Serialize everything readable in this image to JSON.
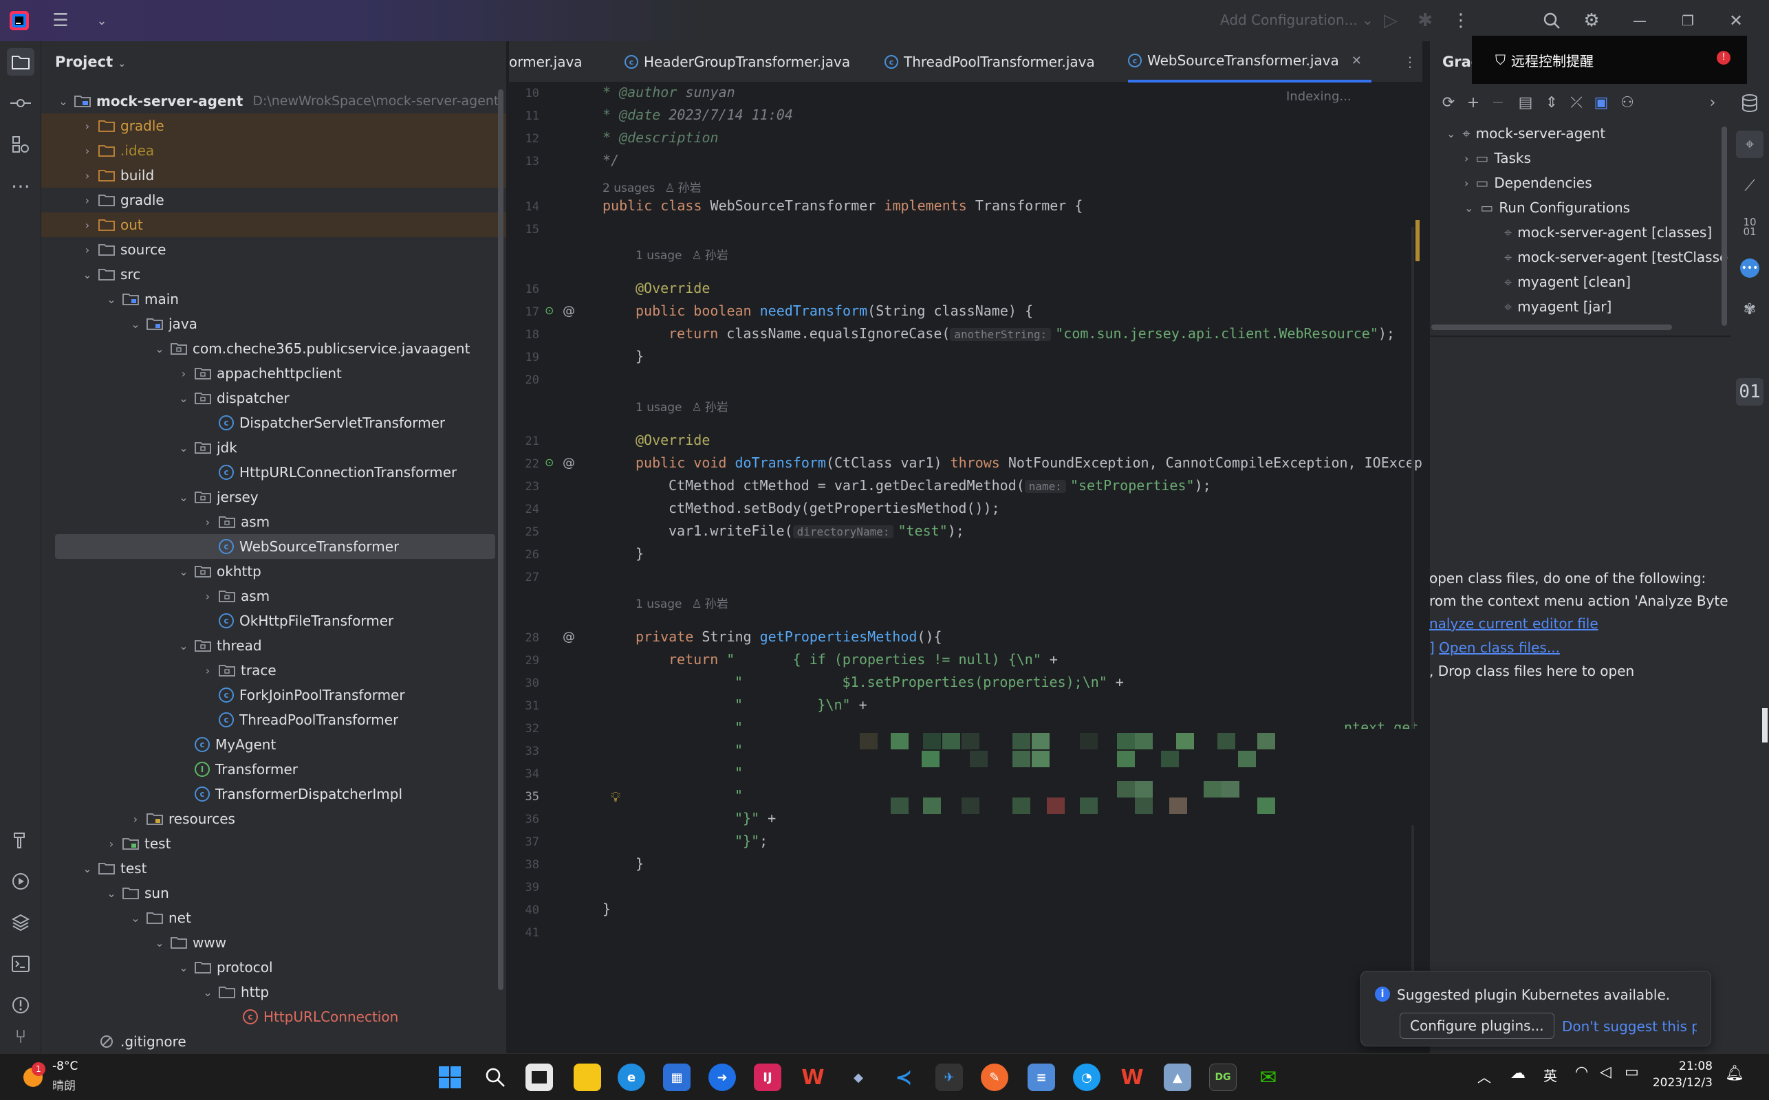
{
  "titlebar": {
    "add_configuration": "Add Configuration..."
  },
  "project_panel": {
    "title": "Project",
    "root": {
      "label": "mock-server-agent",
      "path": "D:\\newWrokSpace\\mock-server-agent"
    },
    "items": [
      {
        "label": "gradle"
      },
      {
        "label": ".idea"
      },
      {
        "label": "build"
      },
      {
        "label": "gradle"
      },
      {
        "label": "out"
      },
      {
        "label": "source"
      },
      {
        "label": "src"
      },
      {
        "label": "main"
      },
      {
        "label": "java"
      },
      {
        "label": "com.cheche365.publicservice.javaagent"
      },
      {
        "label": "appachehttpclient"
      },
      {
        "label": "dispatcher"
      },
      {
        "label": "DispatcherServletTransformer"
      },
      {
        "label": "jdk"
      },
      {
        "label": "HttpURLConnectionTransformer"
      },
      {
        "label": "jersey"
      },
      {
        "label": "asm"
      },
      {
        "label": "WebSourceTransformer"
      },
      {
        "label": "okhttp"
      },
      {
        "label": "asm"
      },
      {
        "label": "OkHttpFileTransformer"
      },
      {
        "label": "thread"
      },
      {
        "label": "trace"
      },
      {
        "label": "ForkJoinPoolTransformer"
      },
      {
        "label": "ThreadPoolTransformer"
      },
      {
        "label": "MyAgent"
      },
      {
        "label": "Transformer"
      },
      {
        "label": "TransformerDispatcherImpl"
      },
      {
        "label": "resources"
      },
      {
        "label": "test"
      },
      {
        "label": "test"
      },
      {
        "label": "sun"
      },
      {
        "label": "net"
      },
      {
        "label": "www"
      },
      {
        "label": "protocol"
      },
      {
        "label": "http"
      },
      {
        "label": "HttpURLConnection"
      },
      {
        "label": ".gitignore"
      }
    ]
  },
  "tabs": [
    {
      "label": "ormer.java"
    },
    {
      "label": "HeaderGroupTransformer.java"
    },
    {
      "label": "ThreadPoolTransformer.java"
    },
    {
      "label": "WebSourceTransformer.java"
    }
  ],
  "editor": {
    "indexing": "Indexing...",
    "line_numbers": [
      "10",
      "11",
      "12",
      "13",
      "14",
      "15",
      "16",
      "17",
      "18",
      "19",
      "20",
      "21",
      "22",
      "23",
      "24",
      "25",
      "26",
      "27",
      "28",
      "29",
      "30",
      "31",
      "32",
      "33",
      "34",
      "35",
      "36",
      "37",
      "38",
      "39",
      "40",
      "41"
    ],
    "usages": {
      "two": "2 usages",
      "one": "1 usage",
      "author": "孙岩"
    },
    "code": {
      "l10_tag": "* @author",
      "l10_val": " sunyan",
      "l11_tag": "* @date",
      "l11_val": " 2023/7/14 11:04",
      "l12": "* @description",
      "l13": "*/",
      "l14_a": "public class",
      "l14_b": " WebSourceTransformer ",
      "l14_c": "implements",
      "l14_d": " Transformer {",
      "l16": "@Override",
      "l17_a": "public boolean ",
      "l17_b": "needTransform",
      "l17_c": "(String className) {",
      "l18_a": "return ",
      "l18_b": "className.equalsIgnoreCase(",
      "l18_hint": "anotherString:",
      "l18_s": "\"com.sun.jersey.api.client.WebResource\"",
      "l18_e": ");",
      "l19": "}",
      "l21": "@Override",
      "l22_a": "public void ",
      "l22_b": "doTransform",
      "l22_c": "(CtClass var1) ",
      "l22_d": "throws",
      "l22_e": " NotFoundException, CannotCompileException, IOExcept",
      "l23_a": "CtMethod ctMethod = var1.getDeclaredMethod(",
      "l23_hint": "name:",
      "l23_s": "\"setProperties\"",
      "l23_e": ");",
      "l24": "ctMethod.setBody(getPropertiesMethod());",
      "l25_a": "var1.writeFile(",
      "l25_hint": "directoryName:",
      "l25_s": "\"test\"",
      "l25_e": ");",
      "l26": "}",
      "l28_a": "private ",
      "l28_b": "String ",
      "l28_c": "getPropertiesMethod",
      "l28_d": "(){",
      "l29_a": "return ",
      "l29_s": "\"       { if (properties != null) {\\n\"",
      "l29_e": " +",
      "l30_s": "\"            $1.setProperties(properties);\\n\"",
      "l30_e": " +",
      "l31_s": "\"         }\\n\"",
      "l31_e": " +",
      "l32_s": "\"",
      "l32_tail": "ntext.get",
      "l33_s": "\"",
      "l33_tail": "st();\\n\"",
      "l34_s": "\"",
      "l34_tail": "ent.threa",
      "l35_s": "\"",
      "l35_tail": ");\\n\" +",
      "l36_s": "\"}\"",
      "l36_e": " +",
      "l37_s": "\"}\"",
      "l37_e": ";",
      "l38": "}",
      "l40": "}"
    }
  },
  "gradle_panel": {
    "title": "Grac",
    "root": "mock-server-agent",
    "nodes": [
      "Tasks",
      "Dependencies",
      "Run Configurations"
    ],
    "run_configs": [
      "mock-server-agent [classes]",
      "mock-server-agent [testClasse",
      "myagent [clean]",
      "myagent [jar]"
    ]
  },
  "bytecode_empty": {
    "line1": "open class files, do one of the following:",
    "line2": "rom the context menu action 'Analyze Byte Co",
    "line3": "nalyze current editor file",
    "line4_pre": "]",
    "line4_link": "Open class files...",
    "line5": ", Drop class files here to open"
  },
  "remote_popup": {
    "label": "远程控制提醒"
  },
  "notification": {
    "message": "Suggested plugin Kubernetes available.",
    "configure": "Configure plugins...",
    "dismiss": "Don't suggest this pl"
  },
  "taskbar": {
    "weather_temp": "-8°C",
    "weather_desc": "晴朗",
    "weather_badge": "1",
    "ime": "英",
    "time": "21:08",
    "date": "2023/12/3"
  },
  "colors": {
    "accent": "#3574f0",
    "keyword": "#cf8e6d",
    "string": "#6aab73",
    "function": "#56a8f5",
    "annotation": "#b3ae60"
  }
}
